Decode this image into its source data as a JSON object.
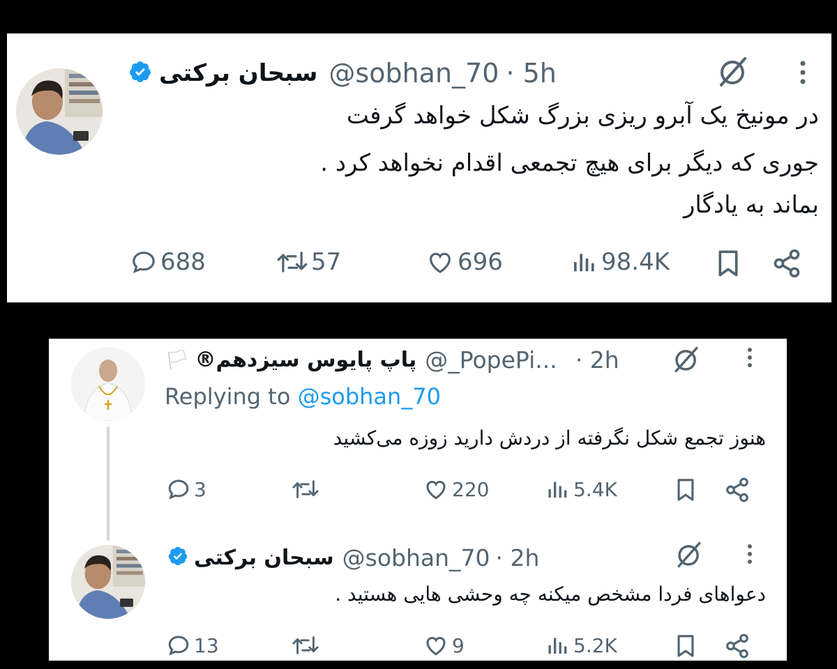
{
  "tweet1": {
    "name": "سبحان برکتی",
    "handle": "@sobhan_70",
    "time": "· 5h",
    "lines": [
      "در مونیخ یک آبرو ریزی بزرگ شکل خواهد گرفت",
      "جوری که دیگر برای هیچ تجمعی اقدام نخواهد کرد .",
      "بماند به یادگار"
    ],
    "replies": "688",
    "reposts": "57",
    "likes": "696",
    "views": "98.4K"
  },
  "tweet2": {
    "name": "پاپ پایوس سیزدهم®",
    "flag": "🏳",
    "handle": "@_PopePi...",
    "time": "· 2h",
    "replying_prefix": "Replying to",
    "replying_handle": "@sobhan_70",
    "text": "هنوز تجمع شکل نگرفته از دردش دارید زوزه می‌کشید",
    "replies": "3",
    "reposts": "",
    "likes": "220",
    "views": "5.4K"
  },
  "tweet3": {
    "name": "سبحان برکتی",
    "handle": "@sobhan_70",
    "time": "· 2h",
    "text": "دعواهای فردا مشخص میکنه چه وحشی هایی هستید .",
    "replies": "13",
    "reposts": "",
    "likes": "9",
    "views": "5.2K"
  },
  "colors": {
    "verified": "#1d9bf0",
    "link": "#1d9bf0",
    "muted": "#536471",
    "text": "#0f1419"
  },
  "icons": [
    "verified-badge-icon",
    "grok-icon",
    "more-icon",
    "reply-icon",
    "repost-icon",
    "like-icon",
    "views-icon",
    "bookmark-icon",
    "share-icon"
  ]
}
